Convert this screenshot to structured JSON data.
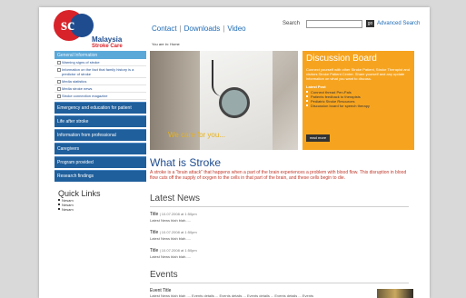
{
  "logo": {
    "mark": "sc",
    "line1": "Malaysia",
    "line2": "Stroke Care"
  },
  "topnav": {
    "contact": "Contact",
    "sep1": "|",
    "downloads": "Downloads",
    "sep2": "|",
    "video": "Video"
  },
  "search": {
    "label": "Search",
    "go": "go",
    "advanced": "Advanced Search"
  },
  "breadcrumb": "You are in: Home",
  "sidebar": {
    "section_heading": "General Information",
    "sub_items": [
      "Warning signs of stroke",
      "Information on the fact that family history is a predictor of stroke",
      "Media statistics",
      "Media stroke news",
      "Stroke connection magazine"
    ],
    "nav_items": [
      "Emergency and education for patient",
      "Life after stroke",
      "Information from professional",
      "Caregivers",
      "Program provided",
      "Research findings"
    ]
  },
  "quick_links": {
    "title": "Quick Links",
    "items": [
      "Nesam",
      "Nesam",
      "Nesam"
    ]
  },
  "hero": {
    "caption": "We care for you..."
  },
  "discussion_board": {
    "title": "Discussion Board",
    "description": "Connect yourself with other Stroke Patient, Stroke Therapist and visitors Stroke Patient Center. Share yourself and any update information on what you want to discuss.",
    "latest_label": "Latest Post",
    "posts": [
      "Connect thread Pen-Pals",
      "Patients feedback to therapists",
      "Pediatric Stroke Resources",
      "Discussion board for speech therapy"
    ],
    "read_more": "read more"
  },
  "what_is_stroke": {
    "title": "What is Stroke",
    "text": "A stroke is a \"brain attack\" that happens when a part of the brain experiences a problem with blood flow. This disruption in blood flow cuts off the supply of oxygen to the cells in that part of the brain, and these cells begin to die."
  },
  "latest_news": {
    "title": "Latest News",
    "items": [
      {
        "title": "Title",
        "date": "| 10.07.2008 at 1:50pm",
        "body": "Latest News blah blah....."
      },
      {
        "title": "Title",
        "date": "| 10.07.2008 at 1:50pm",
        "body": "Latest News blah blah....."
      },
      {
        "title": "Title",
        "date": "| 10.07.2008 at 1:50pm",
        "body": "Latest News blah blah....."
      }
    ]
  },
  "events": {
    "title": "Events",
    "item": {
      "title": "Event Title",
      "body": "Latest News blah blah .... Events details ... Events details ... Events details ... Events details ... Events"
    }
  },
  "colors": {
    "brand_blue": "#1e4c8f",
    "brand_red": "#d8232a",
    "board_orange": "#f6a420",
    "nav_blue": "#1f5f9c"
  }
}
